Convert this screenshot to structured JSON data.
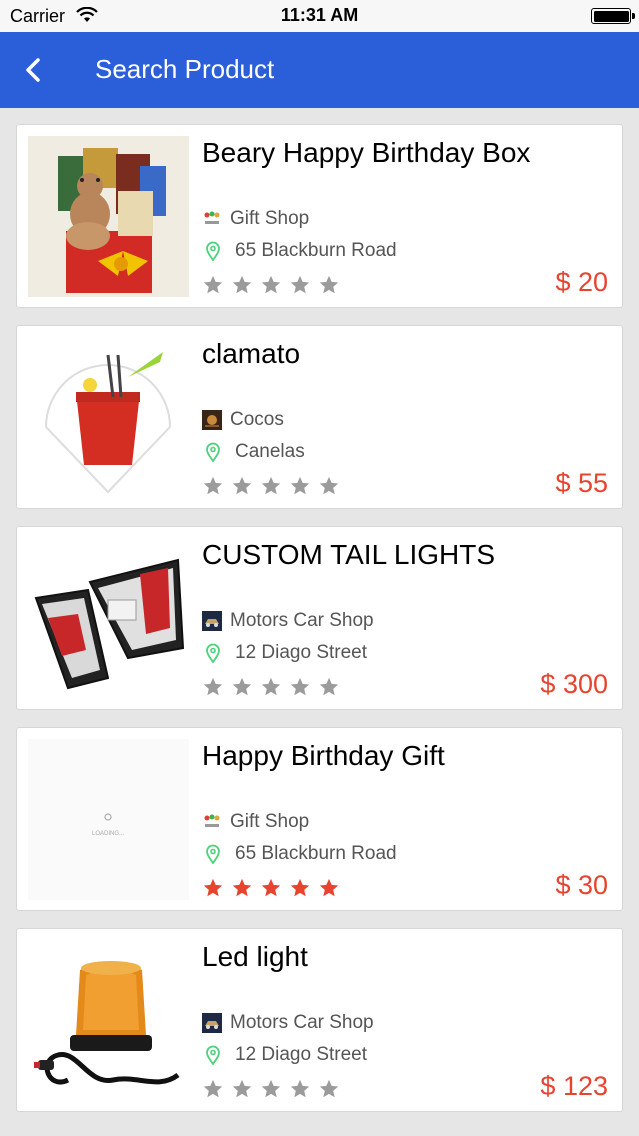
{
  "status_bar": {
    "carrier": "Carrier",
    "time": "11:31 AM"
  },
  "header": {
    "title": "Search Product"
  },
  "products": [
    {
      "name": "Beary Happy Birthday Box",
      "shop": "Gift Shop",
      "address": "65 Blackburn Road",
      "price": "$ 20",
      "rating": 0
    },
    {
      "name": "clamato",
      "shop": "Cocos",
      "address": "Canelas",
      "price": "$ 55",
      "rating": 0
    },
    {
      "name": "CUSTOM TAIL LIGHTS",
      "shop": "Motors Car Shop",
      "address": "12 Diago Street",
      "price": "$ 300",
      "rating": 0
    },
    {
      "name": "Happy Birthday Gift",
      "shop": "Gift Shop",
      "address": "65 Blackburn Road",
      "price": "$ 30",
      "rating": 5,
      "image_text": "LOADING..."
    },
    {
      "name": "Led light",
      "shop": "Motors Car Shop",
      "address": "12 Diago Street",
      "price": "$ 123",
      "rating": 0
    }
  ],
  "colors": {
    "nav": "#2a5fd9",
    "price": "#e8432f",
    "star_on": "#e8432f",
    "star_off": "#9b9b9b",
    "pin": "#4cd27a"
  }
}
